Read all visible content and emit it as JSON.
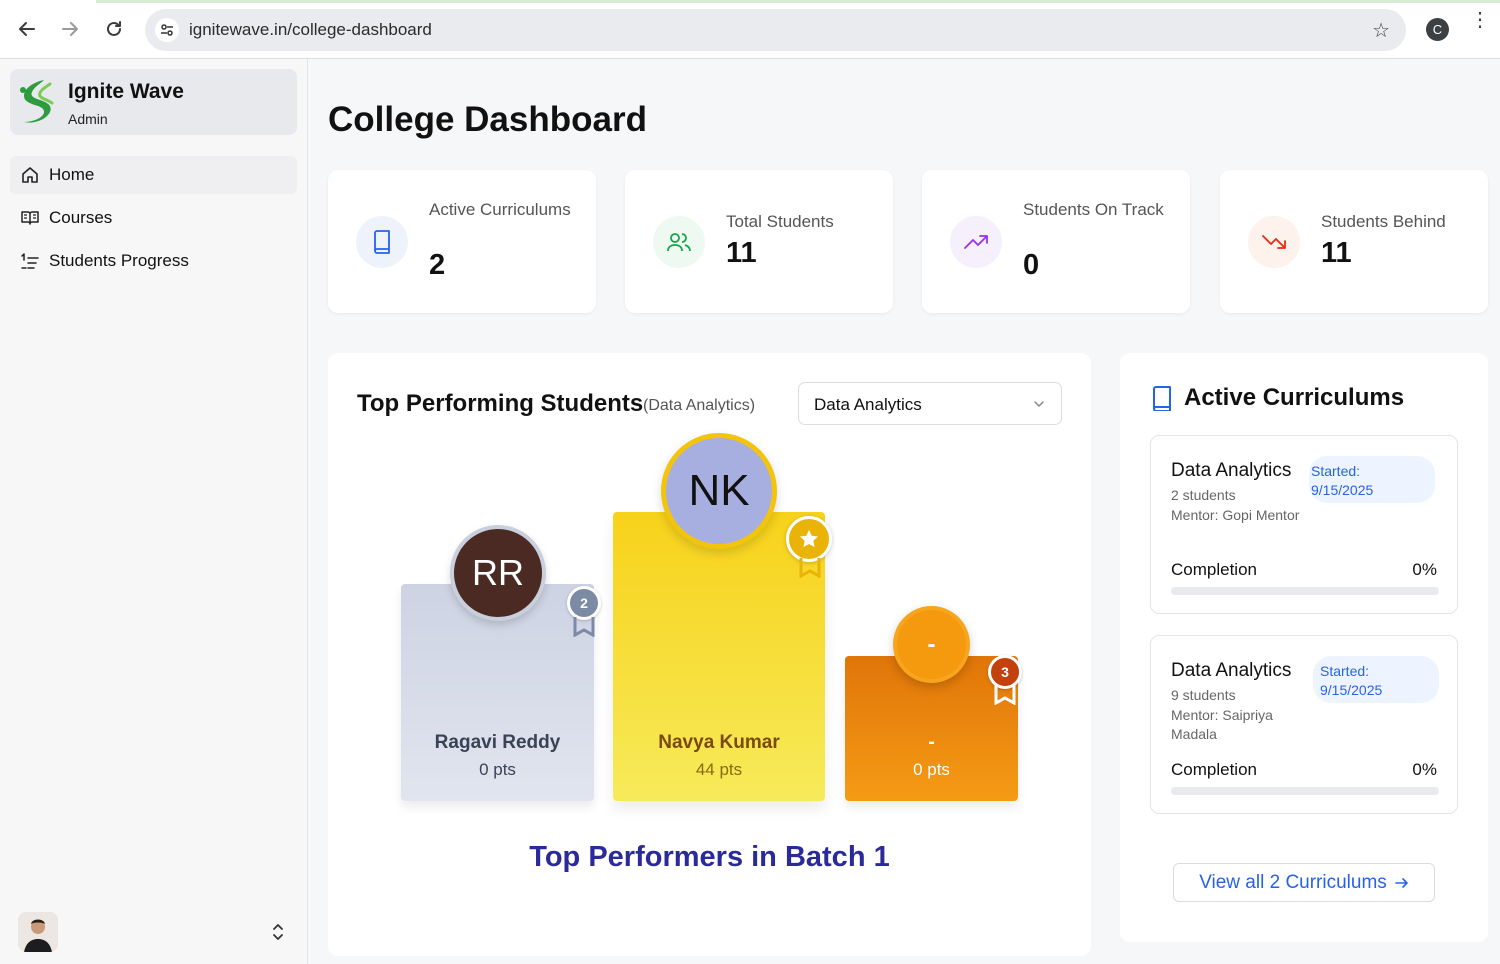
{
  "browser": {
    "url": "ignitewave.in/college-dashboard",
    "profile_initial": "C"
  },
  "sidebar": {
    "brand_name": "Ignite Wave",
    "brand_role": "Admin",
    "items": [
      {
        "label": "Home",
        "icon": "home-icon"
      },
      {
        "label": "Courses",
        "icon": "book-open-icon"
      },
      {
        "label": "Students Progress",
        "icon": "list-ordered-icon"
      }
    ]
  },
  "main": {
    "title": "College Dashboard",
    "stats": [
      {
        "label": "Active Curriculums",
        "value": "2",
        "icon": "book-icon",
        "color": "#2563eb",
        "bg": "#eef2fb"
      },
      {
        "label": "Total Students",
        "value": "11",
        "icon": "users-icon",
        "color": "#16a34a",
        "bg": "#eefaf1"
      },
      {
        "label": "Students On Track",
        "value": "0",
        "icon": "trending-up-icon",
        "color": "#9333ea",
        "bg": "#f6effc"
      },
      {
        "label": "Students Behind",
        "value": "11",
        "icon": "trending-down-icon",
        "color": "#ea580c",
        "bg": "#fdf2ec"
      }
    ],
    "leaderboard": {
      "title": "Top Performing Students",
      "subtitle": "(Data Analytics)",
      "select_value": "Data Analytics",
      "footer": "Top Performers in Batch 1",
      "first": {
        "initials": "NK",
        "name": "Navya Kumar",
        "points": "44 pts"
      },
      "second": {
        "initials": "RR",
        "name": "Ragavi Reddy",
        "points": "0 pts",
        "rank": "2"
      },
      "third": {
        "initials": "-",
        "name": "-",
        "points": "0 pts",
        "rank": "3"
      }
    },
    "curriculums": {
      "title": "Active Curriculums",
      "cards": [
        {
          "name": "Data Analytics",
          "started_label": "Started:",
          "started_date": "9/15/2025",
          "students": "2 students",
          "mentor": "Mentor: Gopi Mentor",
          "completion_label": "Completion",
          "completion": "0%",
          "completion_fraction": 0
        },
        {
          "name": "Data Analytics",
          "started_label": "Started:",
          "started_date": "9/15/2025",
          "students": "9 students",
          "mentor": "Mentor: Saipriya Madala",
          "completion_label": "Completion",
          "completion": "0%",
          "completion_fraction": 0
        }
      ],
      "view_all": "View all 2 Curriculums"
    }
  }
}
